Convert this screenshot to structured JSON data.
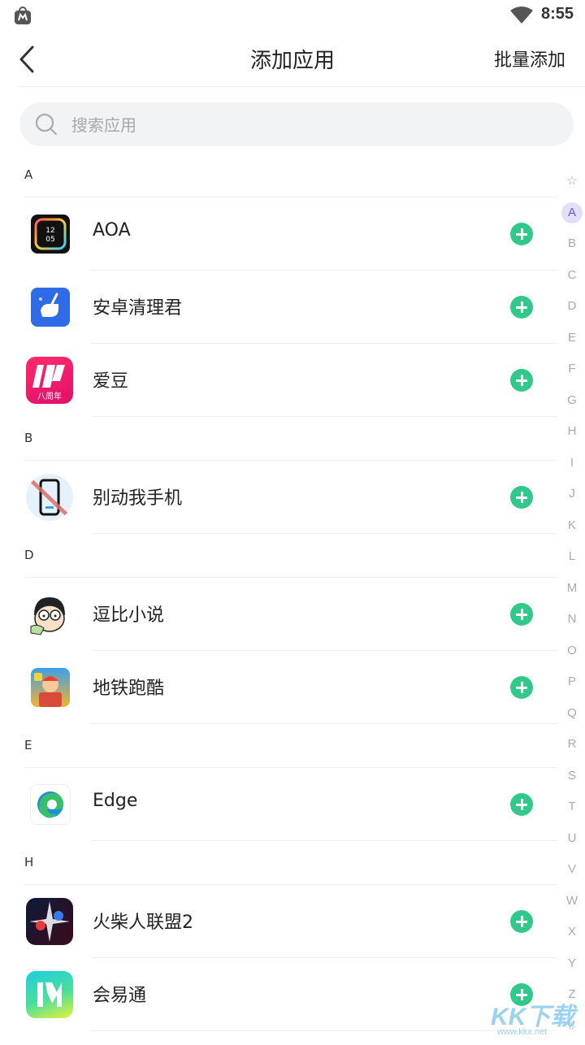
{
  "statusbar": {
    "time": "8:55",
    "icons": [
      "app-notification-icon",
      "wifi-icon"
    ]
  },
  "topbar": {
    "title": "添加应用",
    "batch_label": "批量添加",
    "back_icon": "chevron-left-icon"
  },
  "search": {
    "placeholder": "搜索应用",
    "value": ""
  },
  "sections": [
    {
      "letter": "A",
      "apps": [
        {
          "name": "AOA",
          "icon": "aoa-clock-icon"
        },
        {
          "name": "安卓清理君",
          "icon": "cleaner-broom-icon"
        },
        {
          "name": "爱豆",
          "icon": "aidou-icon",
          "badge": "八周年"
        }
      ]
    },
    {
      "letter": "B",
      "apps": [
        {
          "name": "别动我手机",
          "icon": "phone-forbidden-icon"
        }
      ]
    },
    {
      "letter": "D",
      "apps": [
        {
          "name": "逗比小说",
          "icon": "cartoon-face-icon"
        },
        {
          "name": "地铁跑酷",
          "icon": "subway-surfers-icon"
        }
      ]
    },
    {
      "letter": "E",
      "apps": [
        {
          "name": "Edge",
          "icon": "edge-browser-icon"
        }
      ]
    },
    {
      "letter": "H",
      "apps": [
        {
          "name": "火柴人联盟2",
          "icon": "stickman-league-icon"
        },
        {
          "name": "会易通",
          "icon": "huiyitong-icon"
        }
      ]
    }
  ],
  "index": {
    "items": [
      "☆",
      "A",
      "B",
      "C",
      "D",
      "E",
      "F",
      "G",
      "H",
      "I",
      "J",
      "K",
      "L",
      "M",
      "N",
      "O",
      "P",
      "Q",
      "R",
      "S",
      "T",
      "U",
      "V",
      "W",
      "X",
      "Y",
      "Z",
      "#"
    ],
    "active": "A"
  },
  "colors": {
    "add_button": "#31c98a",
    "index_active": "#6b5bd6",
    "index_active_bg": "#e3defa"
  },
  "watermark": {
    "text": "KK下载",
    "url": "www.kkx.net"
  }
}
